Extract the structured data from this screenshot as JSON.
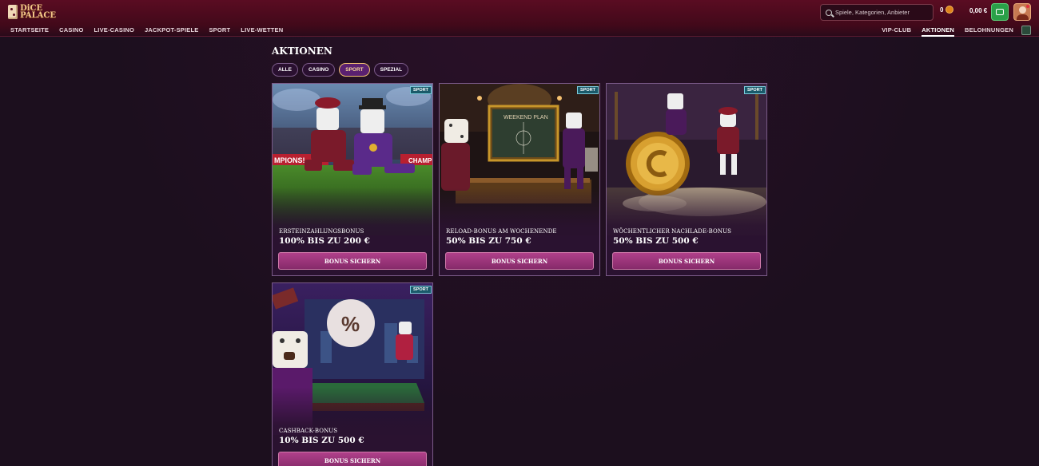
{
  "brand": {
    "logo_line1": "DiCE",
    "logo_line2": "PALACE"
  },
  "nav": {
    "main": [
      "STARTSEITE",
      "CASINO",
      "LIVE-CASINO",
      "JACKPOT-SPIELE",
      "SPORT",
      "LIVE-WETTEN"
    ],
    "right": [
      "VIP-CLUB",
      "AKTIONEN",
      "BELOHNUNGEN"
    ],
    "active_right": "AKTIONEN"
  },
  "search": {
    "placeholder": "Spiele, Kategorien, Anbieter"
  },
  "account": {
    "coins": "0",
    "balance": "0,00 €"
  },
  "page": {
    "title": "AKTIONEN"
  },
  "filters": [
    "ALLE",
    "CASINO",
    "SPORT",
    "SPEZIAL"
  ],
  "active_filter": "SPORT",
  "promotions": [
    {
      "badge": "SPORT",
      "title": "ERSTEINZAHLUNGSBONUS",
      "offer": "100% BIS ZU 200 €",
      "button": "BONUS SICHERN",
      "scene_text_1": "MPIONS!",
      "scene_text_2": "CHAMP"
    },
    {
      "badge": "SPORT",
      "title": "RELOAD-BONUS AM WOCHENENDE",
      "offer": "50% BIS ZU 750 €",
      "button": "BONUS SICHERN",
      "scene_text_1": "WEEKEND PLAN"
    },
    {
      "badge": "SPORT",
      "title": "WÖCHENTLICHER NACHLADE-BONUS",
      "offer": "50% BIS ZU 500 €",
      "button": "BONUS SICHERN"
    },
    {
      "badge": "SPORT",
      "title": "CASHBACK-BONUS",
      "offer": "10% BIS ZU 500 €",
      "button": "BONUS SICHERN",
      "scene_text_1": "%"
    }
  ]
}
